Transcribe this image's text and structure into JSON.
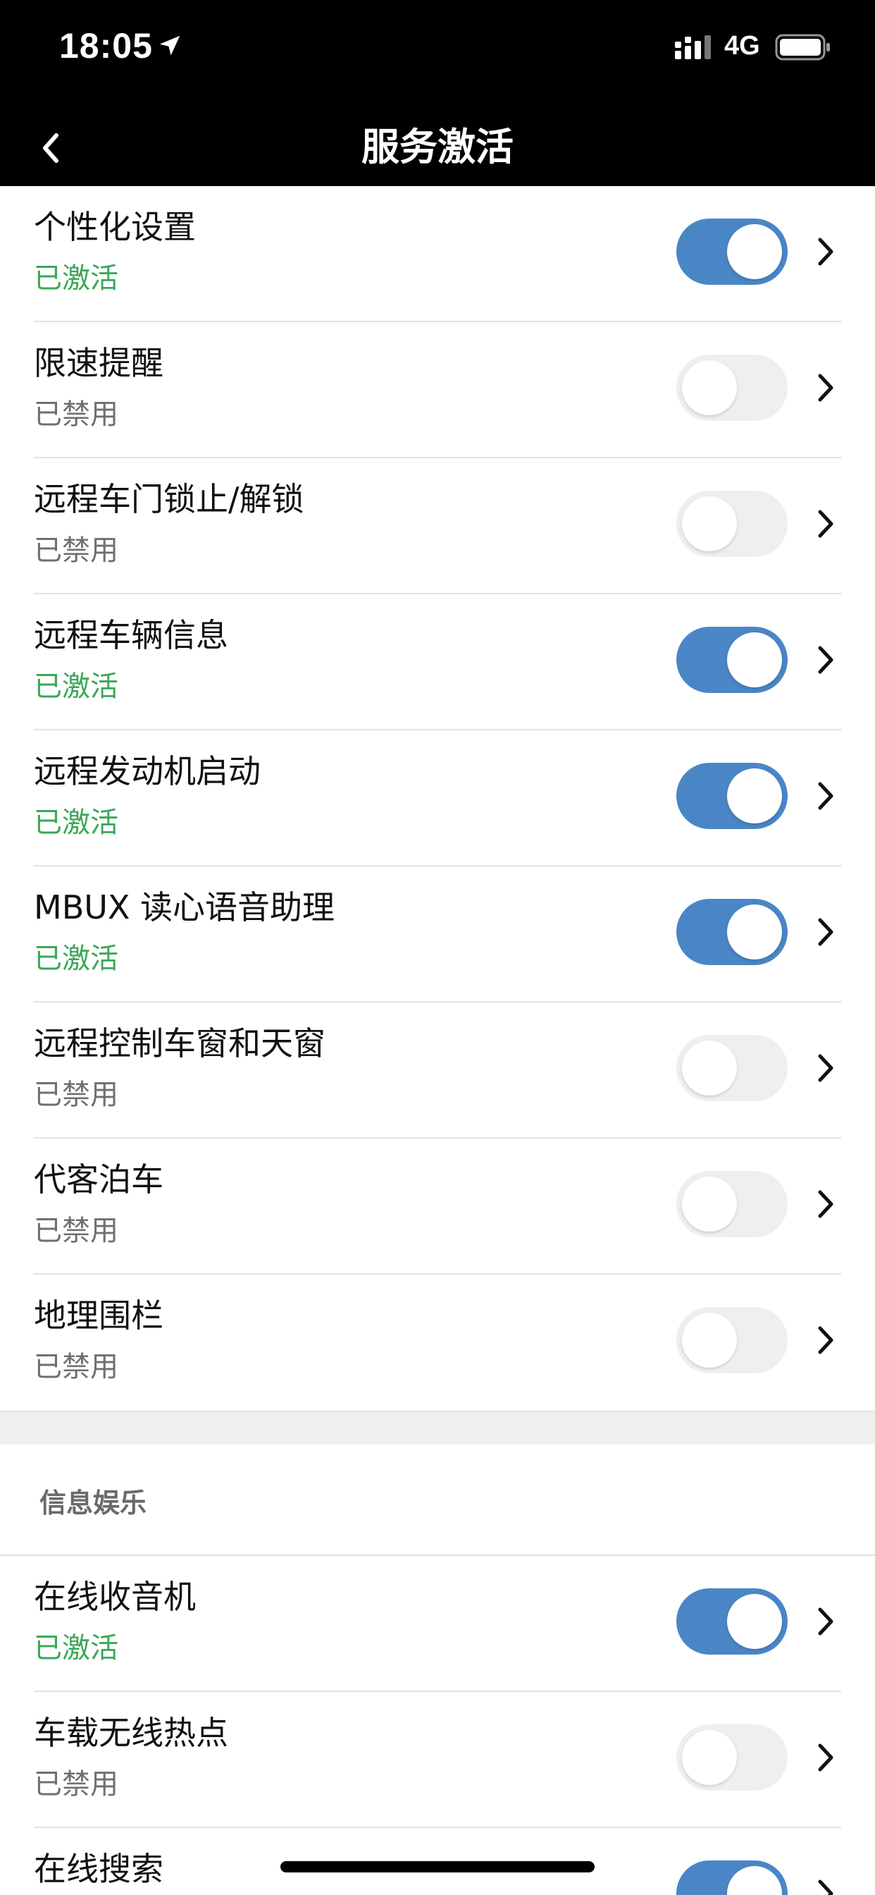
{
  "status_bar": {
    "time": "18:05",
    "network": "4G",
    "icons": [
      "location-arrow-icon",
      "signal-icon",
      "battery-icon"
    ]
  },
  "nav": {
    "title": "服务激活",
    "back_icon": "chevron-left-icon"
  },
  "colors": {
    "header_bg": "#000000",
    "toggle_on": "#4a86c6",
    "toggle_off": "#efefef",
    "status_active": "#3aa757",
    "status_disabled": "#6f6f6f"
  },
  "services": [
    {
      "title": "个性化设置",
      "status": "已激活",
      "enabled": true
    },
    {
      "title": "限速提醒",
      "status": "已禁用",
      "enabled": false
    },
    {
      "title": "远程车门锁止/解锁",
      "status": "已禁用",
      "enabled": false
    },
    {
      "title": "远程车辆信息",
      "status": "已激活",
      "enabled": true
    },
    {
      "title": "远程发动机启动",
      "status": "已激活",
      "enabled": true
    },
    {
      "title": "MBUX 读心语音助理",
      "status": "已激活",
      "enabled": true
    },
    {
      "title": "远程控制车窗和天窗",
      "status": "已禁用",
      "enabled": false
    },
    {
      "title": "代客泊车",
      "status": "已禁用",
      "enabled": false
    },
    {
      "title": "地理围栏",
      "status": "已禁用",
      "enabled": false
    }
  ],
  "infotainment": {
    "section_title": "信息娱乐",
    "items": [
      {
        "title": "在线收音机",
        "status": "已激活",
        "enabled": true
      },
      {
        "title": "车载无线热点",
        "status": "已禁用",
        "enabled": false
      },
      {
        "title": "在线搜索",
        "status": "",
        "enabled": true
      }
    ]
  }
}
